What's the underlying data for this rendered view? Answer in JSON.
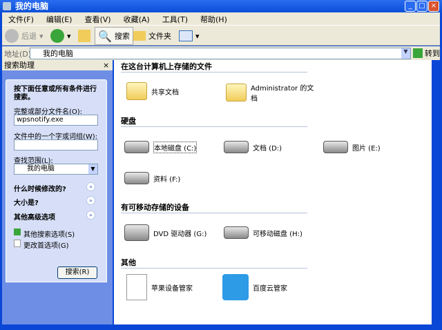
{
  "window": {
    "title": "我的电脑"
  },
  "menu": [
    "文件(F)",
    "编辑(E)",
    "查看(V)",
    "收藏(A)",
    "工具(T)",
    "帮助(H)"
  ],
  "toolbar": {
    "back": "后退",
    "search": "搜索",
    "folders": "文件夹"
  },
  "address": {
    "label": "地址(D)",
    "value": "我的电脑",
    "go": "转到"
  },
  "search_panel": {
    "title": "搜索助理",
    "close": "×",
    "heading": "按下面任意或所有条件进行搜索。",
    "filename_label": "完整或部分文件名(O):",
    "filename_value": "wpsnotify.exe",
    "phrase_label": "文件中的一个字或词组(W):",
    "phrase_value": "",
    "lookin_label": "查找范围(L):",
    "lookin_value": "我的电脑",
    "when_modified": "什么时候修改的?",
    "size": "大小是?",
    "advanced": "其他高级选项",
    "other_options": "其他搜索选项(S)",
    "preferences": "更改首选项(G)",
    "search_button": "搜索(R)"
  },
  "main": {
    "sections": [
      {
        "title": "在这台计算机上存储的文件",
        "items": [
          "共享文档",
          "Administrator 的文档"
        ]
      },
      {
        "title": "硬盘",
        "items": [
          "本地磁盘 (C:)",
          "文档 (D:)",
          "图片 (E:)",
          "资料 (F:)"
        ]
      },
      {
        "title": "有可移动存储的设备",
        "items": [
          "DVD 驱动器 (G:)",
          "可移动磁盘 (H:)"
        ]
      },
      {
        "title": "其他",
        "items": [
          "苹果设备管家",
          "百度云管家"
        ]
      }
    ]
  }
}
